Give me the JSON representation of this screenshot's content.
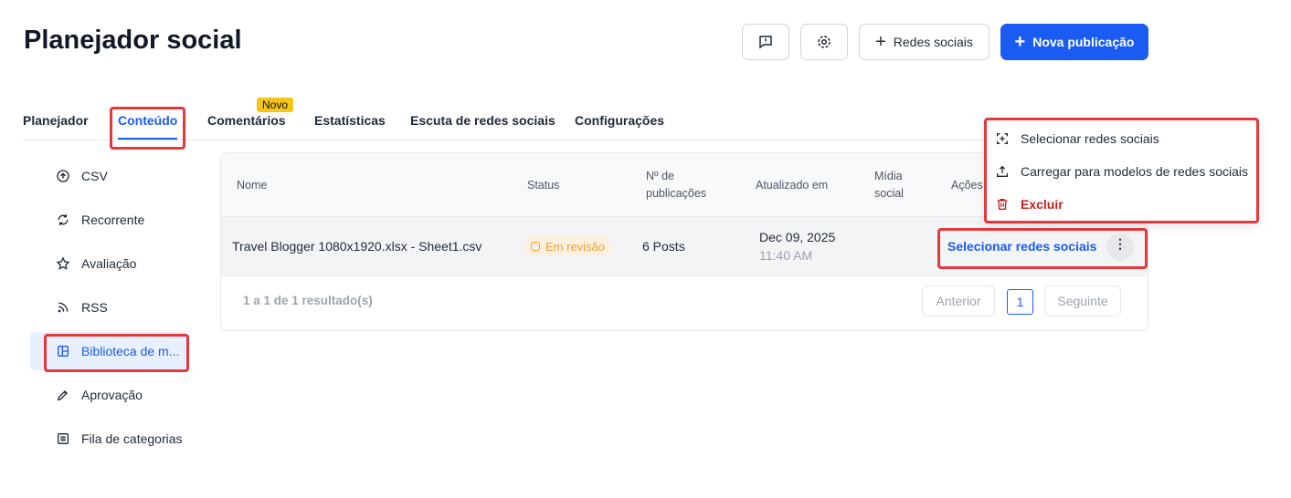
{
  "header": {
    "title": "Planejador social",
    "feedback_icon": "feedback-icon",
    "settings_icon": "gear-icon",
    "social_networks_label": "Redes sociais",
    "new_post_label": "Nova publicação"
  },
  "tabs": [
    {
      "label": "Planejador"
    },
    {
      "label": "Conteúdo",
      "active": true
    },
    {
      "label": "Comentários",
      "badge": "Novo"
    },
    {
      "label": "Estatísticas"
    },
    {
      "label": "Escuta de redes sociais"
    },
    {
      "label": "Configurações"
    }
  ],
  "sidebar": [
    {
      "label": "CSV"
    },
    {
      "label": "Recorrente"
    },
    {
      "label": "Avaliação"
    },
    {
      "label": "RSS"
    },
    {
      "label": "Biblioteca de m...",
      "active": true
    },
    {
      "label": "Aprovação"
    },
    {
      "label": "Fila de categorias"
    }
  ],
  "table": {
    "headers": {
      "name": "Nome",
      "status": "Status",
      "posts_1": "Nº de",
      "posts_2": "publicações",
      "updated": "Atualizado em",
      "media_1": "Mídia",
      "media_2": "social",
      "actions": "Ações"
    },
    "rows": [
      {
        "name": "Travel Blogger 1080x1920.xlsx - Sheet1.csv",
        "status": "Em revisão",
        "posts": "6 Posts",
        "date": "Dec 09, 2025",
        "time": "11:40 AM",
        "action": "Selecionar redes sociais"
      }
    ],
    "summary": "1 a 1 de 1 resultado(s)",
    "pagination": {
      "prev": "Anterior",
      "page": "1",
      "next": "Seguinte"
    }
  },
  "menu": {
    "items": [
      {
        "label": "Selecionar redes sociais"
      },
      {
        "label": "Carregar para modelos de redes sociais"
      },
      {
        "label": "Excluir",
        "color": "#c81e1e"
      }
    ]
  },
  "colors": {
    "accent": "#1a5cf2",
    "highlight": "#e5383b",
    "warning": "#f0a030"
  }
}
